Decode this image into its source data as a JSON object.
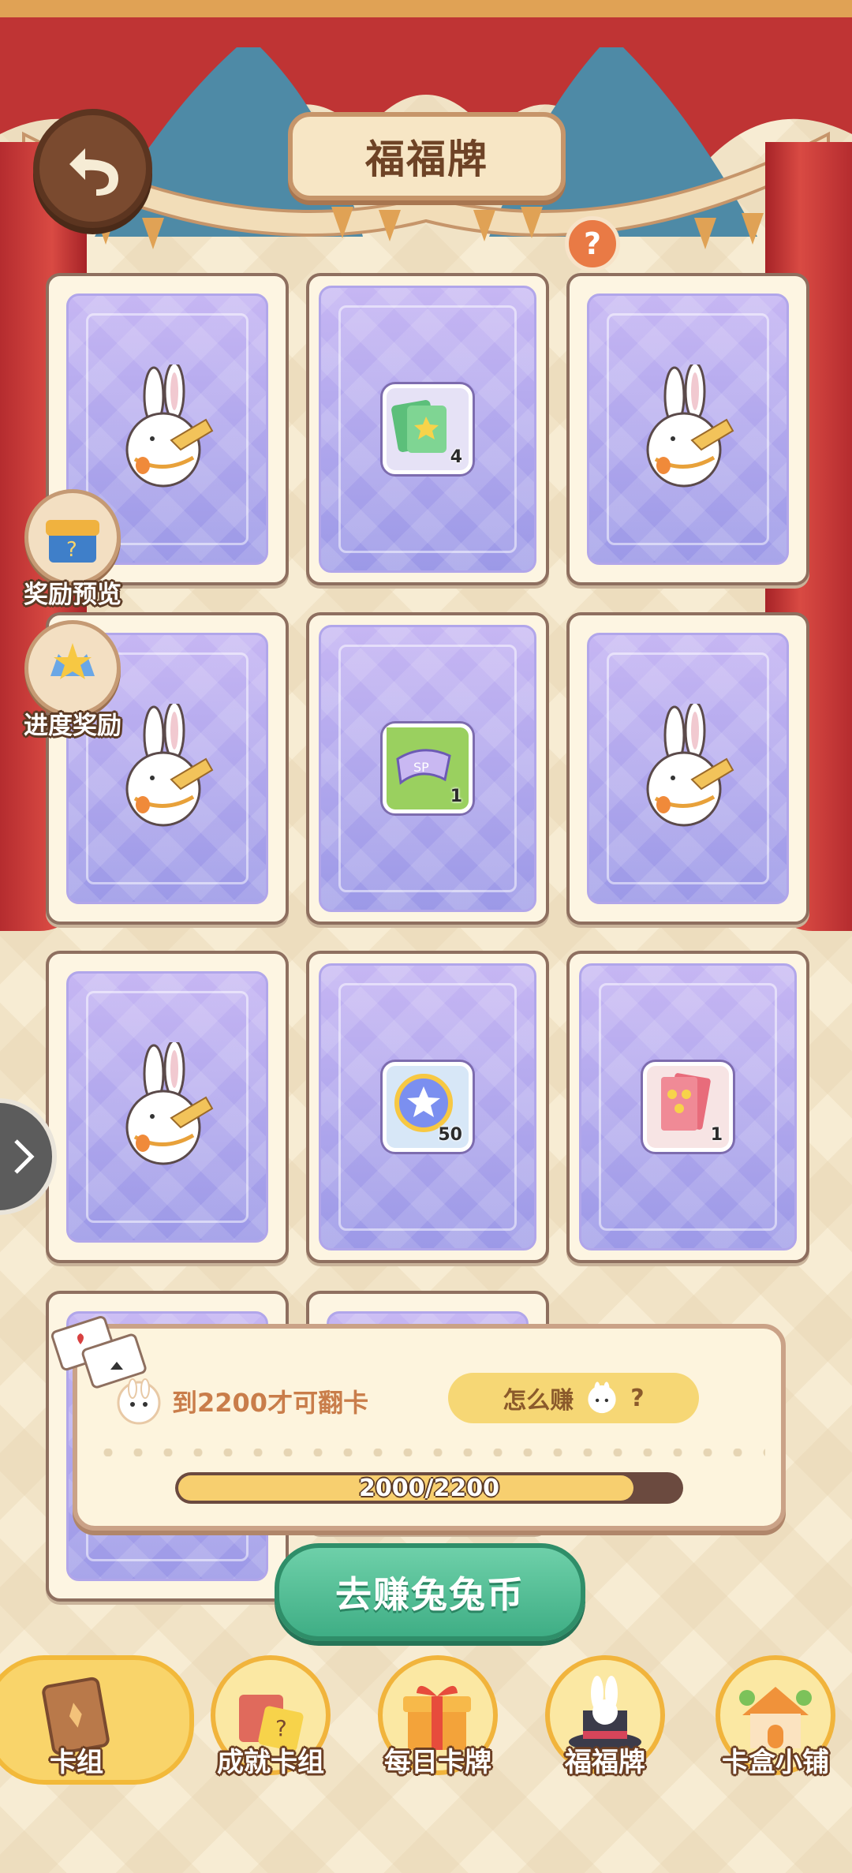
{
  "header": {
    "title": "福福牌",
    "help_label": "?"
  },
  "side_menu": [
    {
      "label": "奖励预览",
      "icon": "treasure-box-icon"
    },
    {
      "label": "进度奖励",
      "icon": "star-badge-icon"
    }
  ],
  "cards": [
    {
      "type": "bunny"
    },
    {
      "type": "prize",
      "icon": "green-ticket-icon",
      "count": "4"
    },
    {
      "type": "bunny"
    },
    {
      "type": "bunny"
    },
    {
      "type": "prize",
      "icon": "purple-ticket-icon",
      "count": "1"
    },
    {
      "type": "bunny"
    },
    {
      "type": "bunny"
    },
    {
      "type": "prize",
      "icon": "star-coin-icon",
      "count": "50"
    },
    {
      "type": "prize",
      "icon": "red-card-pack-icon",
      "count": "1"
    }
  ],
  "flip_panel": {
    "message": "到2200才可翻卡",
    "how_label": "怎么赚",
    "how_suffix": "?",
    "progress_text": "2000/2200",
    "progress_value": 2000,
    "progress_max": 2200
  },
  "earn_button": {
    "label": "去赚兔兔币"
  },
  "bottom_nav": [
    {
      "label": "卡组",
      "icon": "card-book-icon",
      "active": true
    },
    {
      "label": "成就卡组",
      "icon": "achievement-cards-icon",
      "active": false
    },
    {
      "label": "每日卡牌",
      "icon": "gift-box-icon",
      "active": false
    },
    {
      "label": "福福牌",
      "icon": "magic-hat-bunny-icon",
      "active": false
    },
    {
      "label": "卡盒小铺",
      "icon": "shop-house-icon",
      "active": false
    }
  ],
  "colors": {
    "curtain": "#b52c2f",
    "card_back": "#a9a3ea",
    "accent": "#f6d775",
    "earn_button": "#4dbb8f"
  }
}
